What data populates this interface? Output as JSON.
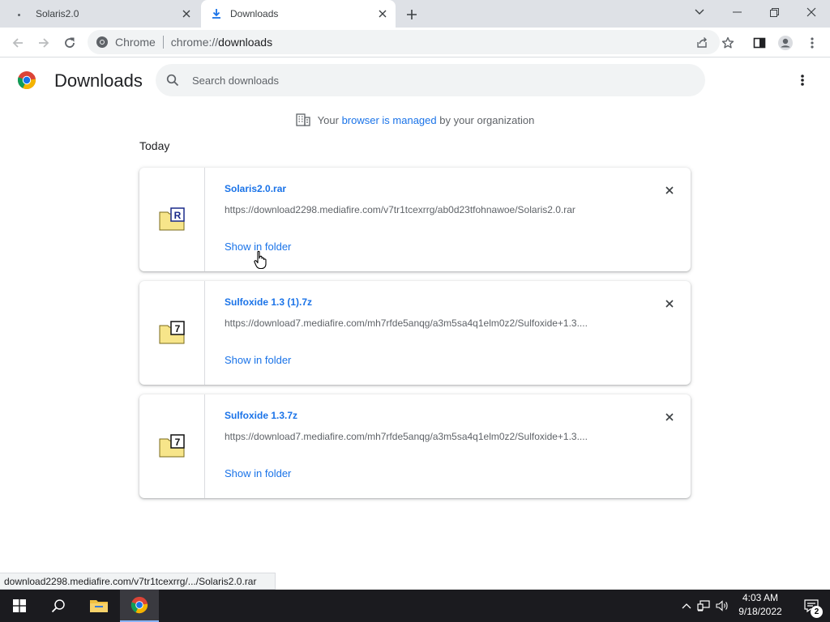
{
  "tabs": [
    {
      "label": "Solaris2.0",
      "active": false
    },
    {
      "label": "Downloads",
      "active": true
    }
  ],
  "toolbar": {
    "site_label": "Chrome",
    "url_scheme": "chrome://",
    "url_path": "downloads"
  },
  "page": {
    "title": "Downloads",
    "search_placeholder": "Search downloads"
  },
  "managed": {
    "prefix": "Your",
    "link": "browser is managed",
    "suffix": "by your organization"
  },
  "section_date": "Today",
  "downloads": [
    {
      "name": "Solaris2.0.rar",
      "url": "https://download2298.mediafire.com/v7tr1tcexrrg/ab0d23tfohnawoe/Solaris2.0.rar",
      "action": "Show in folder",
      "archive_letter": "R"
    },
    {
      "name": "Sulfoxide 1.3 (1).7z",
      "url": "https://download7.mediafire.com/mh7rfde5anqg/a3m5sa4q1elm0z2/Sulfoxide+1.3....",
      "action": "Show in folder",
      "archive_letter": "7"
    },
    {
      "name": "Sulfoxide 1.3.7z",
      "url": "https://download7.mediafire.com/mh7rfde5anqg/a3m5sa4q1elm0z2/Sulfoxide+1.3....",
      "action": "Show in folder",
      "archive_letter": "7"
    }
  ],
  "status_bar": "download2298.mediafire.com/v7tr1tcexrrg/.../Solaris2.0.rar",
  "taskbar": {
    "time": "4:03 AM",
    "date": "9/18/2022",
    "notifications": "2"
  },
  "colors": {
    "accent": "#1a73e8",
    "tabstrip": "#dee1e6",
    "taskbar": "#1b1b1f"
  }
}
